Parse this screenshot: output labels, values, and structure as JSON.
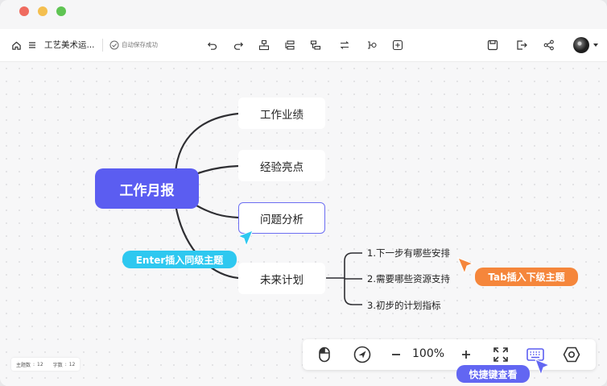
{
  "window": {
    "traffic_lights": [
      "#ef6b5f",
      "#f4bf4f",
      "#5fc453"
    ]
  },
  "toolbar": {
    "doc_name": "工艺美术运...",
    "save_status": "自动保存成功",
    "left_icons": [
      "home-icon",
      "menu-icon"
    ],
    "edit_icons": [
      "undo-icon",
      "redo-icon",
      "insert-parent-icon",
      "insert-sibling-icon",
      "insert-child-icon",
      "relation-icon",
      "summary-icon",
      "add-icon"
    ],
    "right_icons": [
      "save-icon",
      "export-icon",
      "share-icon",
      "avatar"
    ]
  },
  "mindmap": {
    "root": "工作月报",
    "topics": [
      "工作业绩",
      "经验亮点",
      "问题分析",
      "未来计划"
    ],
    "subtopics": [
      "1.下一步有哪些安排",
      "2.需要哪些资源支持",
      "3.初步的计划指标"
    ],
    "colors": {
      "root": "#5b5df1",
      "selected_border": "#6b6df2",
      "line": "#2f2f33"
    }
  },
  "hints": {
    "enter": {
      "label": "Enter插入同级主题",
      "color": "#2ec8f0"
    },
    "tab": {
      "label": "Tab插入下级主题",
      "color": "#f5863b"
    },
    "shortcut": {
      "label": "快捷键查看",
      "color": "#6266f2"
    }
  },
  "zoom": {
    "value": "100%",
    "icons": [
      "mouse-icon",
      "locate-icon",
      "zoom-out-icon",
      "zoom-in-icon",
      "fullscreen-icon",
      "keyboard-icon",
      "settings-icon"
    ]
  },
  "stats": {
    "topic_label": "主题数",
    "topic_value": "12",
    "char_label": "字数",
    "char_value": "12",
    "separator": ":"
  }
}
